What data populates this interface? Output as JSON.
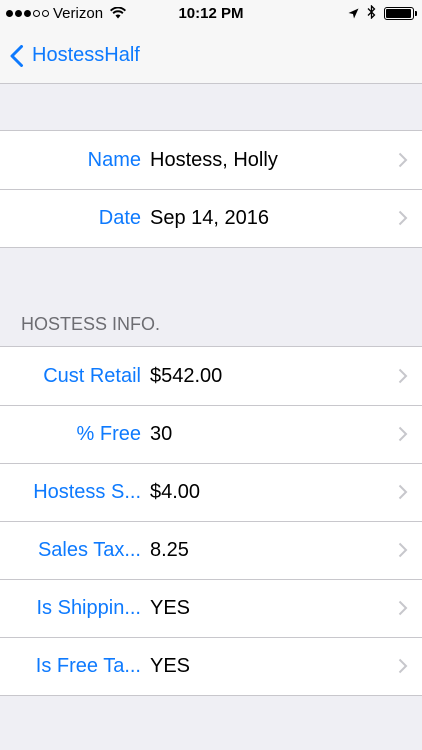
{
  "status_bar": {
    "carrier": "Verizon",
    "time": "10:12 PM"
  },
  "nav": {
    "back_label": "HostessHalf"
  },
  "header_rows": [
    {
      "label": "Name",
      "value": "Hostess, Holly"
    },
    {
      "label": "Date",
      "value": "Sep 14, 2016"
    }
  ],
  "section": {
    "title": "HOSTESS INFO."
  },
  "info_rows": [
    {
      "label": "Cust Retail",
      "value": "$542.00"
    },
    {
      "label": "% Free",
      "value": "30"
    },
    {
      "label": "Hostess S...",
      "value": "$4.00"
    },
    {
      "label": "Sales Tax...",
      "value": "8.25"
    },
    {
      "label": "Is Shippin...",
      "value": "YES"
    },
    {
      "label": "Is Free Ta...",
      "value": "YES"
    }
  ],
  "colors": {
    "accent": "#0e7afe",
    "background": "#efeff4",
    "separator": "#c8c7cc"
  },
  "icons": [
    "wifi-icon",
    "location-arrow-icon",
    "bluetooth-icon",
    "battery-icon",
    "back-chevron-icon",
    "chevron-right-icon"
  ]
}
